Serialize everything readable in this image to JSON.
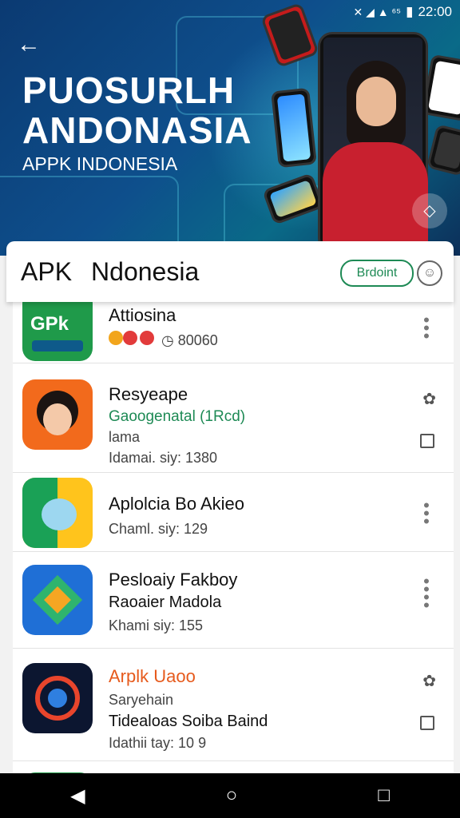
{
  "status_bar": {
    "time": "22:00",
    "battery": "▮",
    "icons": "✕ ◢ ▲ ⁶⁵"
  },
  "hero": {
    "title_line1": "PUOSURLH",
    "title_line2": "ANDONASIA",
    "subtitle": "APPK INDONESIA",
    "back_icon": "←",
    "fab_icon": "◇"
  },
  "app_bar": {
    "brand_part1": "APK",
    "brand_part2": "Ndonesia",
    "pill_label": "Brdoint",
    "account_icon": "☺"
  },
  "apps": [
    {
      "name": "Attiosina",
      "line1": "",
      "line2": "",
      "line3": "◷ 80060"
    },
    {
      "name": "Resyeape",
      "line1": "Gaoogenatal (1Rcd)",
      "line2": "lama",
      "line3": "Idamai. siy: 1380"
    },
    {
      "name": "Aplolcia Bo Akieo",
      "line1": "",
      "line2": "",
      "line3": "Chaml. siy: 129"
    },
    {
      "name": "Pesloaiy Fakboy",
      "line1": "Raoaier Madola",
      "line2": "",
      "line3": "Khami siy: 155"
    },
    {
      "name": "Arplk Uaoo",
      "line1": "Saryehain",
      "line2": "Tidealoas Soiba Baind",
      "line3": "Idathii tay: 10 9"
    }
  ],
  "icon_text": {
    "gpk": "GPk"
  },
  "nav": {
    "back": "◀",
    "home": "○",
    "recents": "□"
  }
}
